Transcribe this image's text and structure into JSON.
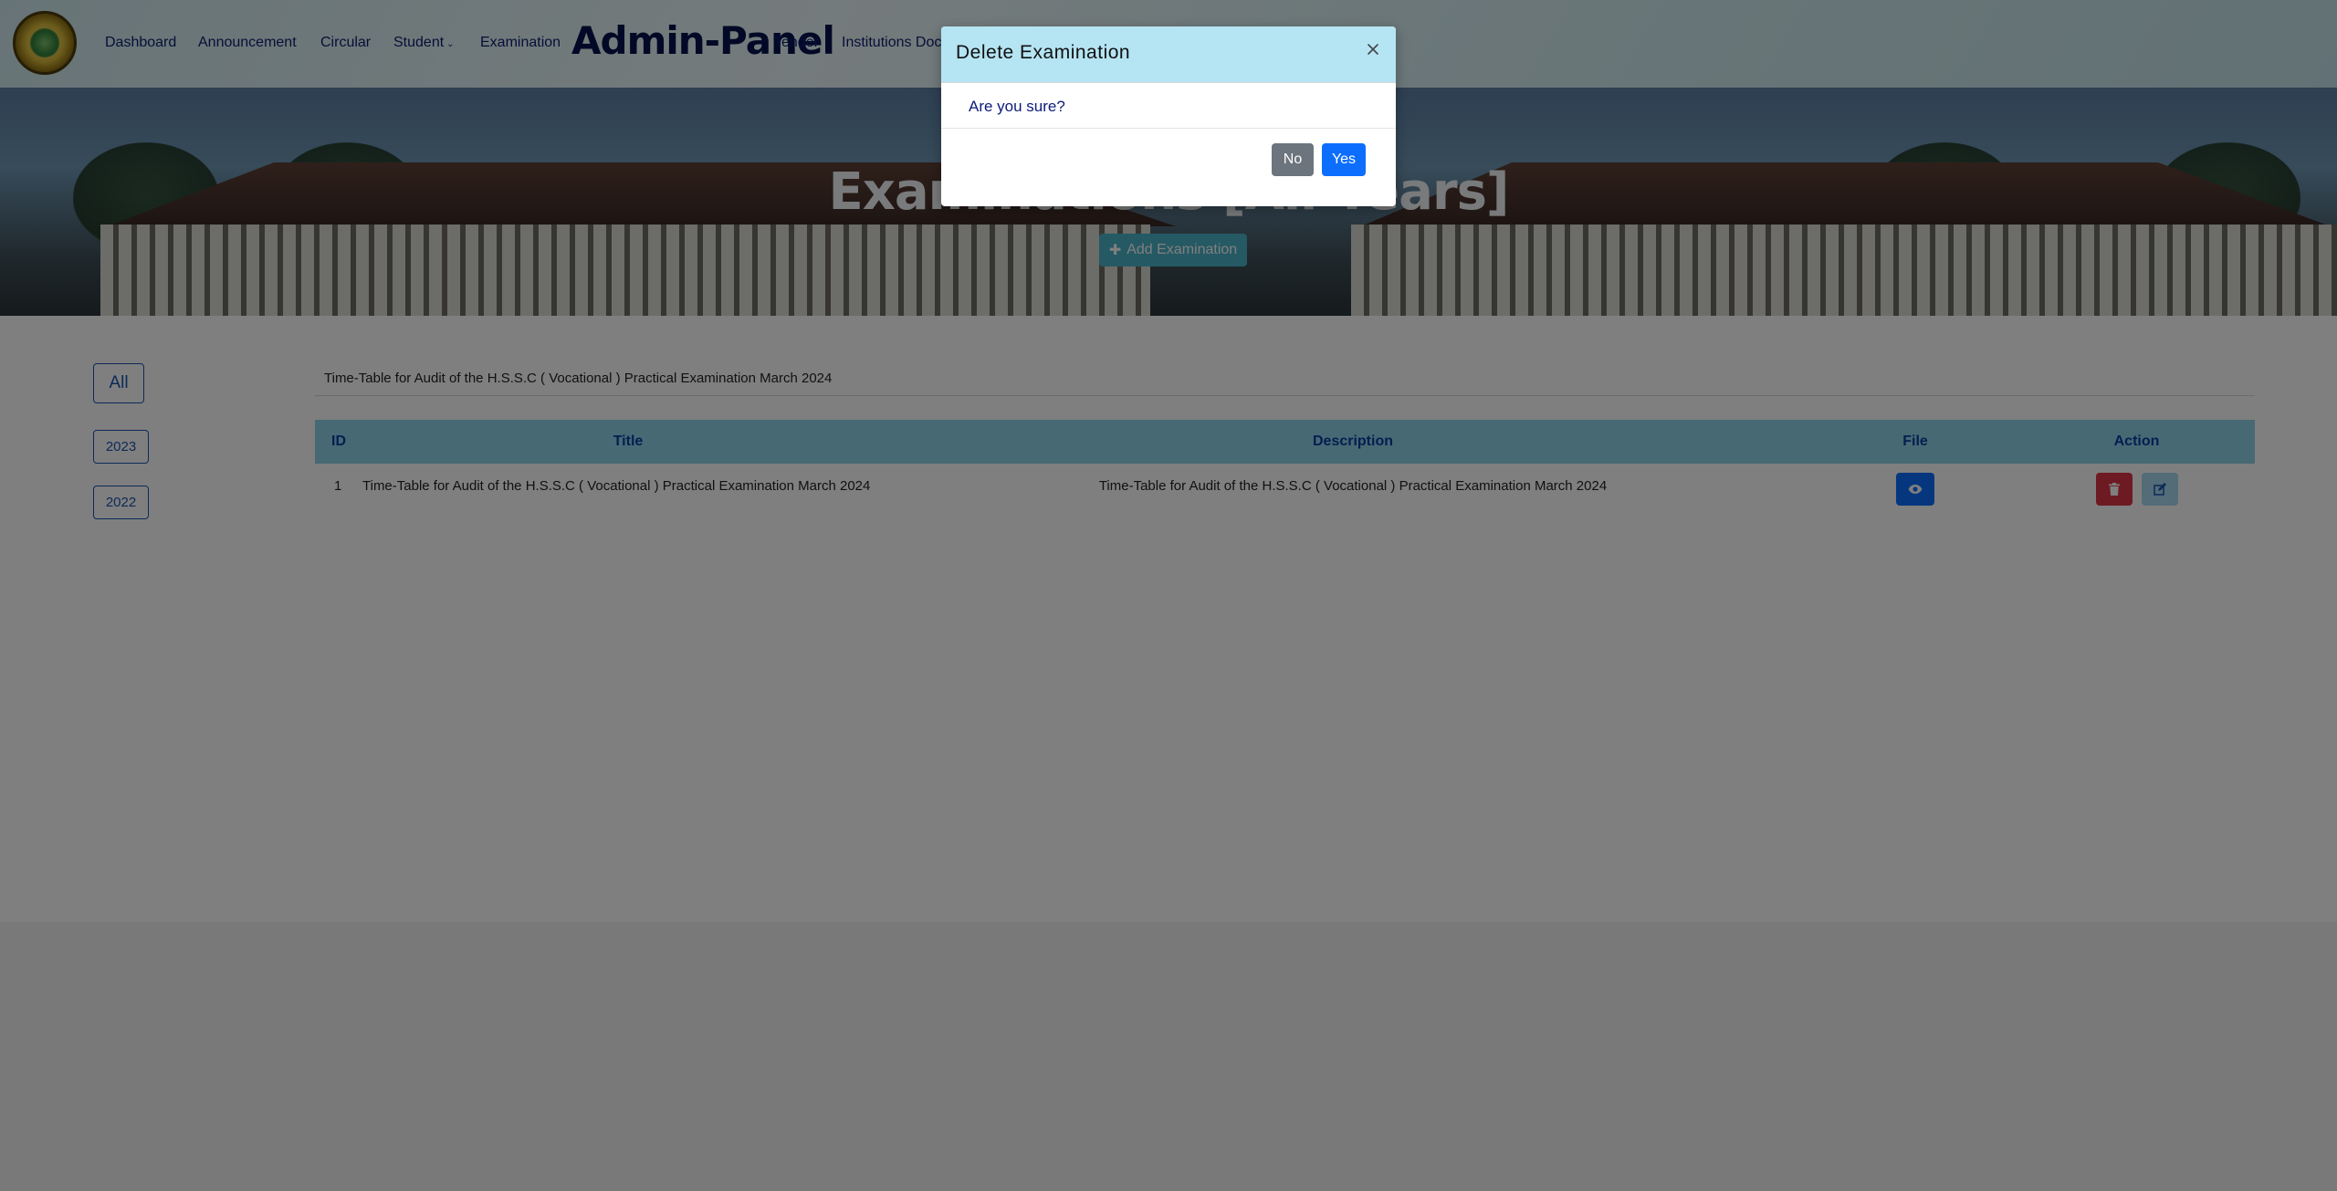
{
  "nav": {
    "items": [
      "Dashboard",
      "Announcement",
      "Circular",
      "Student",
      "Examination",
      "Tender",
      "Institutions Doc"
    ],
    "brand": "Admin-Panel"
  },
  "hero": {
    "title": "Examinations [All Years]",
    "add_button": "Add Examination"
  },
  "filters": {
    "years": [
      "All",
      "2023",
      "2022"
    ]
  },
  "exam_heading": "Time-Table for Audit of the H.S.S.C ( Vocational ) Practical Examination March 2024",
  "table": {
    "headers": [
      "ID",
      "Title",
      "Description",
      "File",
      "Action"
    ],
    "rows": [
      {
        "id": "1",
        "title": "Time-Table for Audit of the H.S.S.C ( Vocational ) Practical Examination March 2024",
        "description": "Time-Table for Audit of the H.S.S.C ( Vocational ) Practical Examination March 2024"
      }
    ]
  },
  "modal": {
    "title": "Delete Examination",
    "question": "Are you sure?",
    "no_label": "No",
    "yes_label": "Yes"
  },
  "colors": {
    "primary": "#0d6efd",
    "danger": "#dc3545",
    "secondary": "#6c757d",
    "modal_header": "#b5e4f3",
    "table_header": "#8fd3e9"
  }
}
